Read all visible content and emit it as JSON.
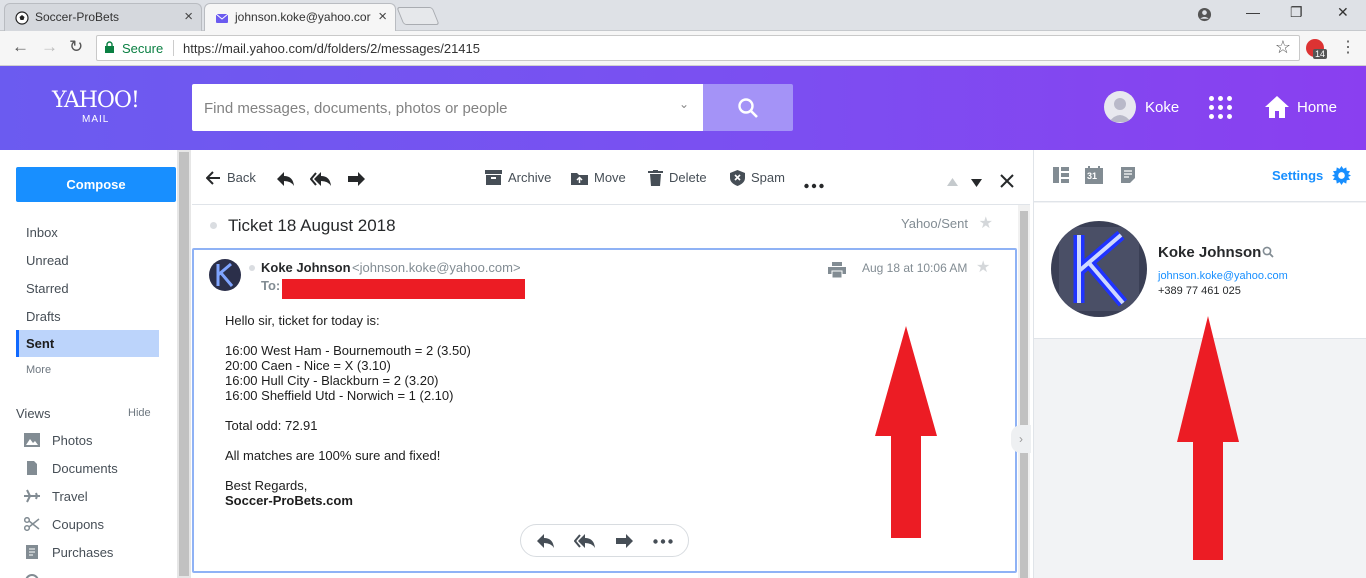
{
  "browser": {
    "tabs": [
      {
        "title": "Soccer-ProBets",
        "close": "×"
      },
      {
        "title": "johnson.koke@yahoo.cor",
        "close": "×"
      }
    ],
    "window_controls": {
      "minimize": "—",
      "restore": "❐",
      "close": "✕"
    },
    "secure_label": "Secure",
    "url": "https://mail.yahoo.com/d/folders/2/messages/21415",
    "extension_badge": "14"
  },
  "header": {
    "logo_main": "YAHOO!",
    "logo_sub": "MAIL",
    "search_placeholder": "Find messages, documents, photos or people",
    "username": "Koke",
    "home_label": "Home",
    "accent_color": "#7b4ff1"
  },
  "sidebar": {
    "compose_label": "Compose",
    "folders": [
      "Inbox",
      "Unread",
      "Starred",
      "Drafts",
      "Sent"
    ],
    "active_folder": "Sent",
    "more_label": "More",
    "views_heading": "Views",
    "hide_label": "Hide",
    "views": [
      {
        "label": "Photos",
        "icon": "photo-icon"
      },
      {
        "label": "Documents",
        "icon": "document-icon"
      },
      {
        "label": "Travel",
        "icon": "plane-icon"
      },
      {
        "label": "Coupons",
        "icon": "scissors-icon"
      },
      {
        "label": "Purchases",
        "icon": "receipt-icon"
      }
    ]
  },
  "toolbar": {
    "back_label": "Back",
    "archive_label": "Archive",
    "move_label": "Move",
    "delete_label": "Delete",
    "spam_label": "Spam"
  },
  "message": {
    "subject": "Ticket 18 August 2018",
    "folder_label": "Yahoo/Sent",
    "sender_name": "Koke Johnson",
    "sender_email": "<johnson.koke@yahoo.com>",
    "to_label": "To:",
    "date": "Aug 18 at 10:06 AM",
    "body": {
      "greeting": "Hello sir, ticket for today is:",
      "matches": [
        "16:00 West Ham - Bournemouth = 2 (3.50)",
        "20:00 Caen - Nice = X (3.10)",
        "16:00 Hull City - Blackburn = 2 (3.20)",
        "16:00 Sheffield Utd - Norwich = 1 (2.10)"
      ],
      "total": "Total odd: 72.91",
      "claim": "All matches are 100% sure and fixed!",
      "closing": "Best Regards,",
      "signature": "Soccer-ProBets.com"
    }
  },
  "contact_pane": {
    "settings_label": "Settings",
    "calendar_day": "31",
    "contact_name": "Koke Johnson",
    "contact_email": "johnson.koke@yahoo.com",
    "contact_phone": "+389 77 461 025",
    "avatar_letter": "K"
  },
  "annotation_color": "#ec1c24"
}
